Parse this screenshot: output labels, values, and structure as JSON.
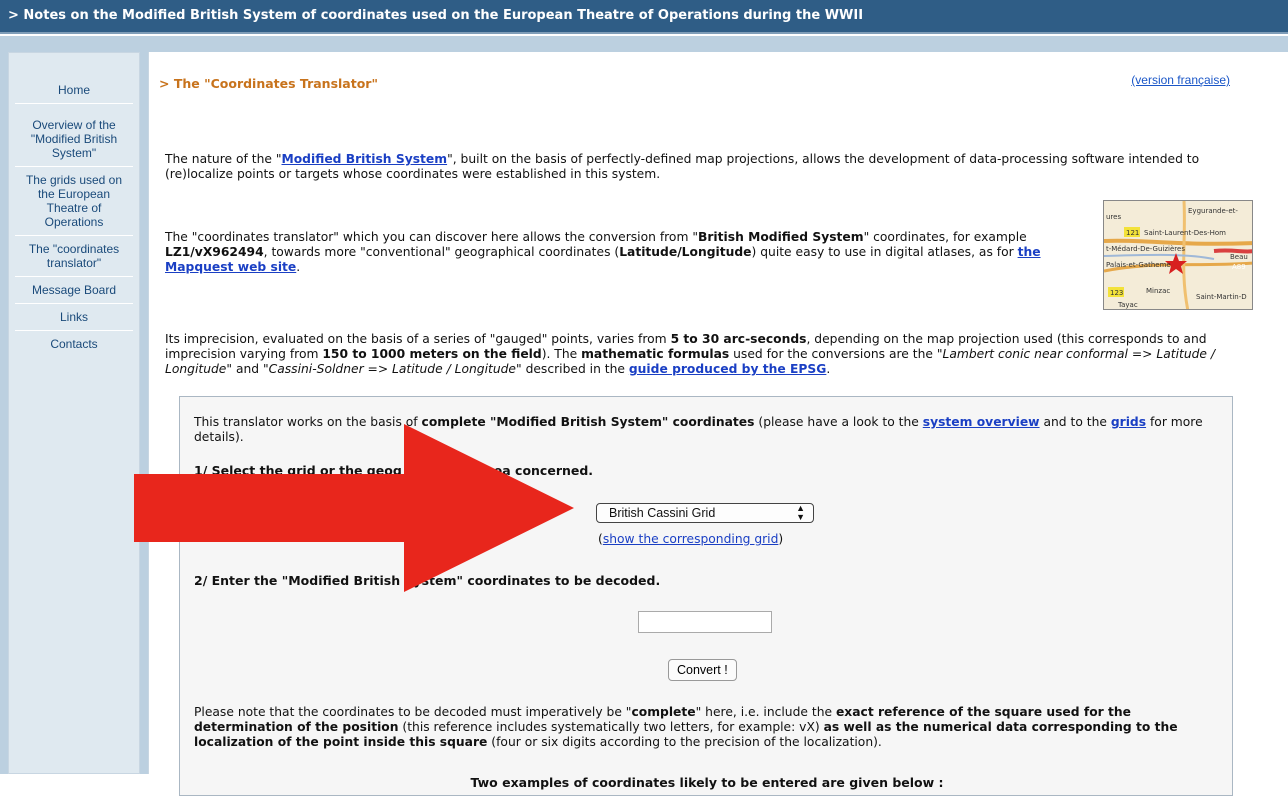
{
  "header": {
    "title": "> Notes on the Modified British System of coordinates used on the European Theatre of Operations during the WWII"
  },
  "sidebar": {
    "items": [
      {
        "label": "Home"
      },
      {
        "label": "Overview of the \"Modified British System\""
      },
      {
        "label": "The grids used on the European Theatre of Operations"
      },
      {
        "label": "The \"coordinates translator\""
      },
      {
        "label": "Message Board"
      },
      {
        "label": "Links"
      },
      {
        "label": "Contacts"
      }
    ]
  },
  "main": {
    "title": "> The \"Coordinates Translator\"",
    "version_link": "(version française)",
    "p1": {
      "a": "The nature of the \"",
      "link": "Modified British System",
      "b": "\", built on the basis of perfectly-defined map projections, allows the development of data-processing software intended to (re)localize points or targets whose coordinates were established in this system."
    },
    "p2": {
      "a": "The \"coordinates translator\" which you can discover here allows the conversion from \"",
      "b1": "British Modified System",
      "c": "\" coordinates, for example ",
      "b2": "LZ1/vX962494",
      "d": ", towards more \"conventional\" geographical coordinates (",
      "b3": "Latitude/Longitude",
      "e": ") quite easy to use in digital atlases, as for ",
      "link": "the Mapquest web site",
      "f": "."
    },
    "map": {
      "labels": [
        "Eygurande-et-",
        "121",
        "Saint-Laurent-Des-Hom",
        "t-Médard-De-Guizières",
        "Beau",
        "Palais-et-Gatheme",
        "A89",
        "123",
        "Minzac",
        "Saint-Martin-D",
        "Tayac",
        "ures"
      ]
    },
    "p3": {
      "a": "Its imprecision, evaluated on the basis of a series of \"gauged\" points, varies from ",
      "b1": "5 to 30 arc-seconds",
      "c": ", depending on the map projection used (this corresponds to and imprecision varying from ",
      "b2": "150 to 1000 meters on the field",
      "d": "). The ",
      "b3": "mathematic formulas",
      "e": " used for the conversions are the \"",
      "i1": "Lambert conic near conformal => Latitude / Longitude",
      "f": "\" and \"",
      "i2": "Cassini-Soldner => Latitude / Longitude",
      "g": "\" described in the ",
      "link": "guide produced by the EPSG",
      "h": "."
    },
    "box": {
      "intro": {
        "a": "This translator works on the basis of ",
        "b1": "complete \"Modified British System\" coordinates",
        "c": " (please have a look to the ",
        "link1": "system overview",
        "d": " and to the ",
        "link2": "grids",
        "e": " for more details)."
      },
      "step1_a": "1/ Select the grid or the geog",
      "step1_b": "ea concerned.",
      "select_value": "British Cassini Grid",
      "show_grid": {
        "open": "(",
        "link": "show the corresponding grid",
        "close": ")"
      },
      "step2": "2/ Enter the \"Modified British System\" coordinates to be decoded.",
      "input_value": "",
      "convert_label": "Convert !",
      "note": {
        "a": "Please note that the coordinates to be decoded must imperatively be \"",
        "b1": "complete",
        "c": "\" here, i.e. include the ",
        "b2": "exact reference of the square used for the determination of the position",
        "d": " (this reference includes systematically two letters, for example: vX) ",
        "b3": "as well as the numerical data corresponding to the localization of the point inside this square",
        "e": " (four or six digits according to the precision of the localization)."
      },
      "examples_title": "Two examples of coordinates likely to be entered are given below :"
    }
  },
  "colors": {
    "header_bg": "#2f5d86",
    "title_orange": "#c8731c",
    "link_blue": "#1a3fc4",
    "arrow_red": "#e8261c"
  }
}
